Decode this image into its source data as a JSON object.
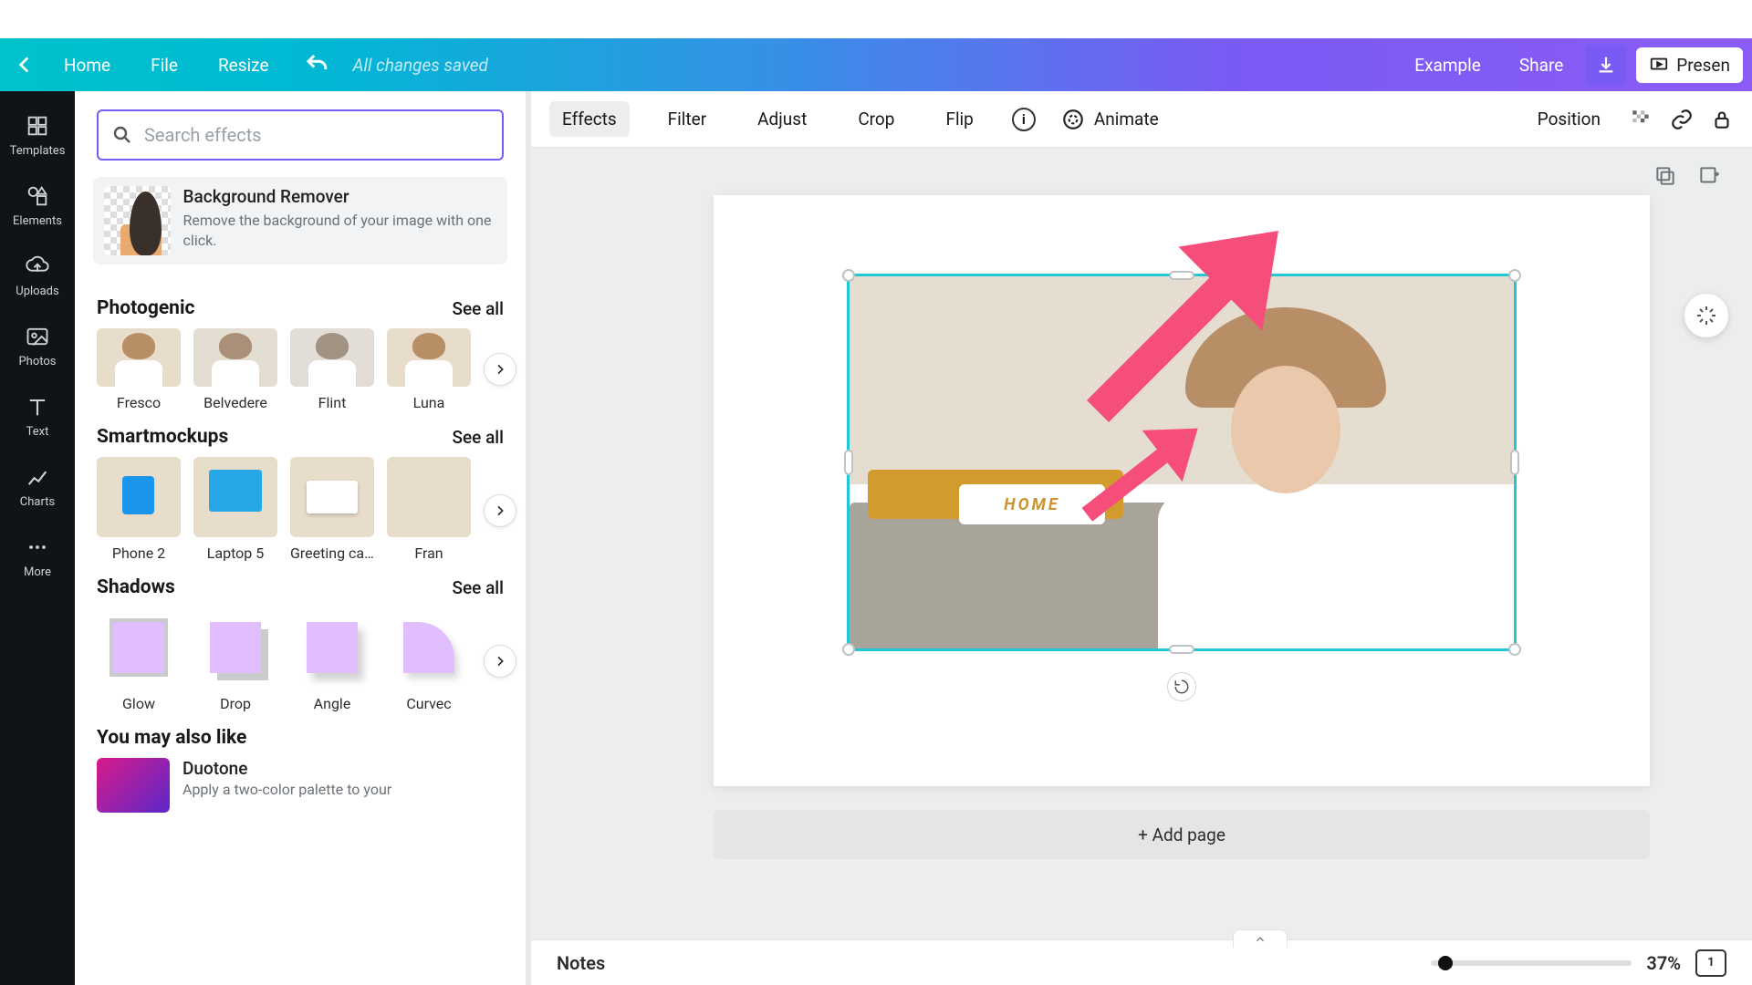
{
  "topbar": {
    "home": "Home",
    "file": "File",
    "resize": "Resize",
    "saved": "All changes saved",
    "example": "Example",
    "share": "Share",
    "present": "Presen"
  },
  "rail": {
    "templates": "Templates",
    "elements": "Elements",
    "uploads": "Uploads",
    "photos": "Photos",
    "text": "Text",
    "charts": "Charts",
    "more": "More"
  },
  "panel": {
    "search_placeholder": "Search effects",
    "bg_remover": {
      "title": "Background Remover",
      "desc": "Remove the background of your image with one click."
    },
    "photogenic": {
      "title": "Photogenic",
      "see_all": "See all",
      "items": [
        "Fresco",
        "Belvedere",
        "Flint",
        "Luna"
      ]
    },
    "smartmockups": {
      "title": "Smartmockups",
      "see_all": "See all",
      "items": [
        "Phone 2",
        "Laptop 5",
        "Greeting car...",
        "Fran"
      ]
    },
    "shadows": {
      "title": "Shadows",
      "see_all": "See all",
      "items": [
        "Glow",
        "Drop",
        "Angle",
        "Curvec"
      ]
    },
    "also": {
      "title": "You may also like",
      "duotone_title": "Duotone",
      "duotone_desc": "Apply a two-color palette to your"
    }
  },
  "toolbar": {
    "effects": "Effects",
    "filter": "Filter",
    "adjust": "Adjust",
    "crop": "Crop",
    "flip": "Flip",
    "animate": "Animate",
    "position": "Position"
  },
  "canvas": {
    "add_page": "+ Add page"
  },
  "status": {
    "notes": "Notes",
    "zoom": "37%",
    "pages": "1"
  }
}
